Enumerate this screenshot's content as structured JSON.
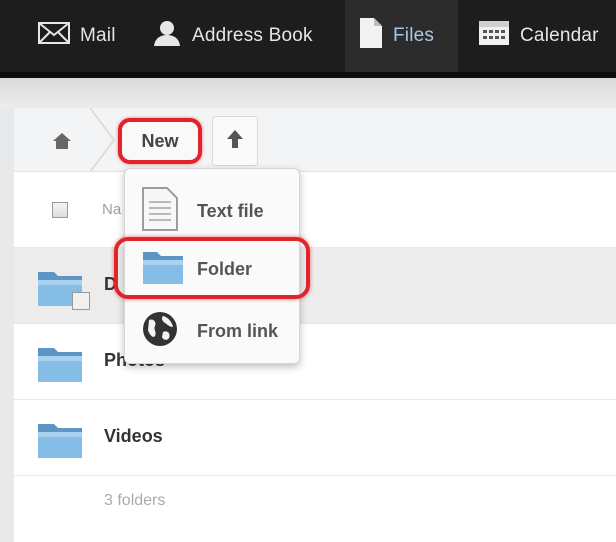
{
  "nav": {
    "items": [
      {
        "label": "Mail",
        "icon": "envelope-icon"
      },
      {
        "label": "Address Book",
        "icon": "person-icon"
      },
      {
        "label": "Files",
        "icon": "document-icon",
        "active": true
      },
      {
        "label": "Calendar",
        "icon": "calendar-icon"
      }
    ]
  },
  "controls": {
    "new_label": "New"
  },
  "header": {
    "name_col": "Na"
  },
  "menu": {
    "items": [
      {
        "label": "Text file",
        "icon": "text-file-icon"
      },
      {
        "label": "Folder",
        "icon": "folder-icon"
      },
      {
        "label": "From link",
        "icon": "globe-icon"
      }
    ]
  },
  "files": {
    "rows": [
      {
        "name": "D",
        "type": "folder",
        "shared": true
      },
      {
        "name": "Photos",
        "type": "folder"
      },
      {
        "name": "Videos",
        "type": "folder"
      }
    ],
    "summary": "3 folders"
  },
  "colors": {
    "nav_bg": "#1d1d1d",
    "active_text": "#a9c8e6",
    "highlight": "#e0242b",
    "folder_blue": "#6fa8d6"
  }
}
